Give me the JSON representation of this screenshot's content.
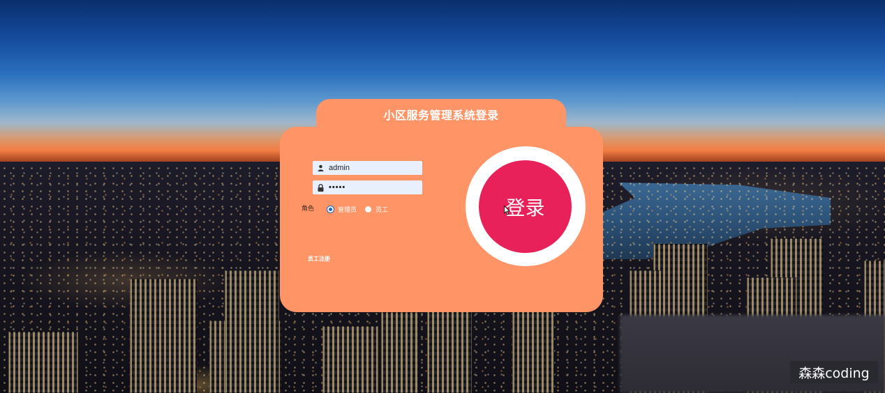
{
  "login": {
    "title": "小区服务管理系统登录",
    "username_value": "admin",
    "password_value": "•••••",
    "role_label": "角色",
    "roles": [
      {
        "label": "管理员",
        "checked": true
      },
      {
        "label": "员工",
        "checked": false
      }
    ],
    "register_link": "员工注册",
    "login_button": "登录"
  },
  "watermark": {
    "text": "森森coding"
  },
  "icons": {
    "username": "user-icon",
    "password": "lock-icon",
    "cursor": "mouse-cursor-icon"
  },
  "colors": {
    "card": "#ff9466",
    "login_button": "#e8215a",
    "input_bg": "#e8f0fe",
    "radio_selected": "#1e63c9"
  }
}
